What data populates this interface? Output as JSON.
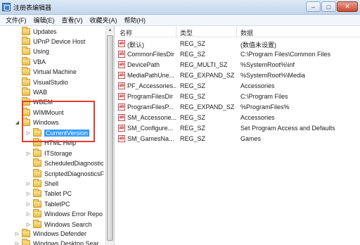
{
  "window": {
    "title": "注册表编辑器",
    "min": "–",
    "max": "□",
    "close": "✕"
  },
  "menu": [
    "文件(F)",
    "编辑(E)",
    "查看(V)",
    "收藏夹(A)",
    "帮助(H)"
  ],
  "tree": [
    {
      "label": "Updates",
      "expander": "",
      "selected": false
    },
    {
      "label": "UPnP Device Host",
      "expander": "",
      "selected": false
    },
    {
      "label": "Using",
      "expander": "",
      "selected": false
    },
    {
      "label": "VBA",
      "expander": "",
      "selected": false
    },
    {
      "label": "Virtual Machine",
      "expander": "",
      "selected": false
    },
    {
      "label": "VisualStudio",
      "expander": "",
      "selected": false
    },
    {
      "label": "WAB",
      "expander": "",
      "selected": false
    },
    {
      "label": "WBEM",
      "expander": "",
      "selected": false
    },
    {
      "label": "WIMMount",
      "expander": "",
      "selected": false
    },
    {
      "label": "Windows",
      "expander": "◢",
      "selected": false
    },
    {
      "label": "CurrentVersion",
      "expander": "▷",
      "selected": true
    },
    {
      "label": "HTML Help",
      "expander": "",
      "selected": false
    },
    {
      "label": "ITStorage",
      "expander": "▷",
      "selected": false
    },
    {
      "label": "ScheduledDiagnostic",
      "expander": "",
      "selected": false
    },
    {
      "label": "ScriptedDiagnosticsF",
      "expander": "",
      "selected": false
    },
    {
      "label": "Shell",
      "expander": "▷",
      "selected": false
    },
    {
      "label": "Tablet PC",
      "expander": "▷",
      "selected": false
    },
    {
      "label": "TabletPC",
      "expander": "▷",
      "selected": false
    },
    {
      "label": "Windows Error Repo",
      "expander": "▷",
      "selected": false
    },
    {
      "label": "Windows Search",
      "expander": "▷",
      "selected": false
    },
    {
      "label": "Windows Defender",
      "expander": "▷",
      "selected": false
    },
    {
      "label": "Windows Desktop Sear",
      "expander": "▷",
      "selected": false
    }
  ],
  "columns": {
    "name": "名称",
    "type": "类型",
    "data": "数据"
  },
  "values": [
    {
      "name": "(默认)",
      "type": "REG_SZ",
      "data": "(数值未设置)"
    },
    {
      "name": "CommonFilesDir",
      "type": "REG_SZ",
      "data": "C:\\Program Files\\Common Files"
    },
    {
      "name": "DevicePath",
      "type": "REG_MULTI_SZ",
      "data": "%SystemRoot%\\inf"
    },
    {
      "name": "MediaPathUne...",
      "type": "REG_EXPAND_SZ",
      "data": "%SystemRoot%\\Media"
    },
    {
      "name": "PF_Accessories...",
      "type": "REG_SZ",
      "data": "Accessories"
    },
    {
      "name": "ProgramFilesDir",
      "type": "REG_SZ",
      "data": "C:\\Program Files"
    },
    {
      "name": "ProgramFilesP...",
      "type": "REG_EXPAND_SZ",
      "data": "%ProgramFiles%"
    },
    {
      "name": "SM_Accessorie...",
      "type": "REG_SZ",
      "data": "Accessories"
    },
    {
      "name": "SM_Configure...",
      "type": "REG_SZ",
      "data": "Set Program Access and Defaults"
    },
    {
      "name": "SM_GamesNa...",
      "type": "REG_SZ",
      "data": "Games"
    }
  ],
  "value_icon": "ab"
}
